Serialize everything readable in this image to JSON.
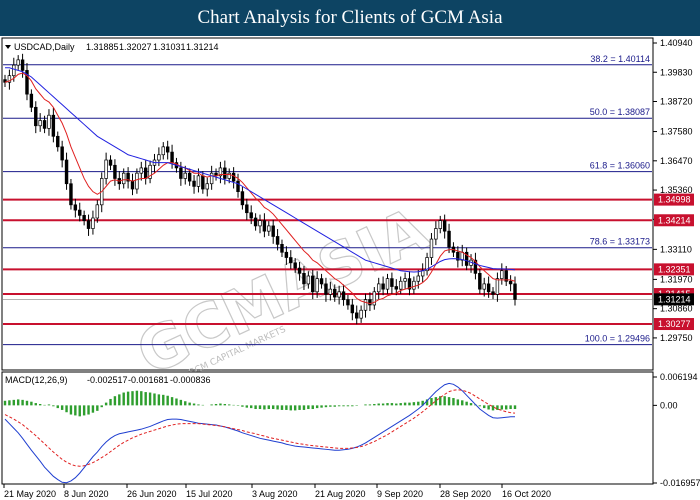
{
  "banner": {
    "title": "Chart Analysis for Clients of GCM Asia"
  },
  "header": {
    "symbol": "USDCAD,Daily",
    "open": "1.31885",
    "high": "1.32027",
    "low": "1.31031",
    "close": "1.31214"
  },
  "watermark": {
    "text": "GCMASIA",
    "sub": "GCM CAPITAL MARKETS"
  },
  "macd": {
    "label": "MACD(12,26,9)",
    "values": [
      "-0.002517",
      "-0.001681",
      "-0.000836"
    ]
  },
  "colors": {
    "banner": "#0d4463",
    "ma_fast": "#e02020",
    "ma_slow": "#2020e0",
    "resistance": "#c8102e",
    "fib": "#1a1a8a",
    "macd_hist": "#2e9e2e",
    "macd_line": "#1f3fd0",
    "macd_signal": "#e02020"
  },
  "chart_data": [
    {
      "type": "candlestick",
      "ylim": [
        1.2895,
        1.4094
      ],
      "yticks": [
        "1.40940",
        "1.39830",
        "1.38720",
        "1.37580",
        "1.36470",
        "1.35360",
        "1.34250",
        "1.33110",
        "1.31970",
        "1.30860",
        "1.29750"
      ],
      "xlabels": [
        "21 May 2020",
        "8 Jun 2020",
        "26 Jun 2020",
        "15 Jul 2020",
        "3 Aug 2020",
        "21 Aug 2020",
        "9 Sep 2020",
        "28 Sep 2020",
        "16 Oct 2020"
      ],
      "closes": [
        1.3945,
        1.397,
        1.401,
        1.403,
        1.399,
        1.39,
        1.385,
        1.378,
        1.38,
        1.377,
        1.382,
        1.374,
        1.37,
        1.365,
        1.356,
        1.348,
        1.346,
        1.344,
        1.342,
        1.339,
        1.343,
        1.348,
        1.358,
        1.365,
        1.363,
        1.358,
        1.356,
        1.36,
        1.357,
        1.354,
        1.36,
        1.362,
        1.358,
        1.363,
        1.365,
        1.367,
        1.37,
        1.368,
        1.364,
        1.362,
        1.358,
        1.36,
        1.357,
        1.355,
        1.359,
        1.354,
        1.356,
        1.36,
        1.359,
        1.362,
        1.358,
        1.36,
        1.357,
        1.353,
        1.348,
        1.345,
        1.343,
        1.34,
        1.342,
        1.338,
        1.34,
        1.336,
        1.333,
        1.33,
        1.328,
        1.326,
        1.324,
        1.322,
        1.318,
        1.321,
        1.315,
        1.32,
        1.318,
        1.314,
        1.316,
        1.313,
        1.315,
        1.312,
        1.31,
        1.307,
        1.305,
        1.308,
        1.312,
        1.31,
        1.315,
        1.318,
        1.316,
        1.32,
        1.317,
        1.316,
        1.319,
        1.32,
        1.316,
        1.319,
        1.321,
        1.323,
        1.328,
        1.335,
        1.339,
        1.342,
        1.338,
        1.332,
        1.33,
        1.327,
        1.33,
        1.325,
        1.327,
        1.322,
        1.316,
        1.318,
        1.315,
        1.314,
        1.32,
        1.323,
        1.319,
        1.318,
        1.3121
      ],
      "series": [
        {
          "values": [
            1.3945,
            1.395,
            1.396,
            1.3975,
            1.398,
            1.397,
            1.395,
            1.392,
            1.39,
            1.388,
            1.387,
            1.385,
            1.382,
            1.379,
            1.375,
            1.37,
            1.366,
            1.362,
            1.358,
            1.355,
            1.353,
            1.352,
            1.353,
            1.355,
            1.357,
            1.3575,
            1.357,
            1.3575,
            1.3575,
            1.357,
            1.3575,
            1.358,
            1.358,
            1.359,
            1.36,
            1.3615,
            1.363,
            1.364,
            1.364,
            1.3635,
            1.3625,
            1.362,
            1.361,
            1.36,
            1.36,
            1.359,
            1.3585,
            1.359,
            1.359,
            1.3595,
            1.3595,
            1.3595,
            1.359,
            1.358,
            1.3565,
            1.3545,
            1.3525,
            1.3505,
            1.349,
            1.347,
            1.346,
            1.3445,
            1.3425,
            1.3405,
            1.3385,
            1.3365,
            1.3345,
            1.3325,
            1.3305,
            1.329,
            1.327,
            1.326,
            1.3245,
            1.323,
            1.3215,
            1.32,
            1.319,
            1.3175,
            1.316,
            1.3145,
            1.3125,
            1.3115,
            1.311,
            1.3105,
            1.311,
            1.312,
            1.3125,
            1.3135,
            1.314,
            1.3145,
            1.3155,
            1.316,
            1.3165,
            1.317,
            1.3175,
            1.3185,
            1.32,
            1.3225,
            1.3255,
            1.3285,
            1.3305,
            1.331,
            1.331,
            1.3305,
            1.33,
            1.329,
            1.328,
            1.3265,
            1.3245,
            1.323,
            1.3215,
            1.32,
            1.3195,
            1.3195,
            1.3195,
            1.3195,
            1.319
          ]
        },
        {
          "values": [
            1.4,
            1.4,
            1.3995,
            1.399,
            1.3985,
            1.3975,
            1.3965,
            1.395,
            1.3935,
            1.392,
            1.3905,
            1.389,
            1.3875,
            1.386,
            1.3845,
            1.383,
            1.3815,
            1.38,
            1.3785,
            1.377,
            1.3755,
            1.374,
            1.373,
            1.372,
            1.371,
            1.37,
            1.369,
            1.368,
            1.367,
            1.3665,
            1.366,
            1.3655,
            1.365,
            1.3645,
            1.364,
            1.364,
            1.364,
            1.364,
            1.3635,
            1.363,
            1.3625,
            1.362,
            1.3615,
            1.361,
            1.3605,
            1.36,
            1.3595,
            1.359,
            1.3585,
            1.358,
            1.3575,
            1.357,
            1.3565,
            1.356,
            1.355,
            1.354,
            1.353,
            1.352,
            1.351,
            1.35,
            1.349,
            1.348,
            1.347,
            1.346,
            1.345,
            1.344,
            1.343,
            1.342,
            1.341,
            1.34,
            1.339,
            1.338,
            1.337,
            1.336,
            1.335,
            1.334,
            1.333,
            1.332,
            1.331,
            1.33,
            1.329,
            1.328,
            1.327,
            1.3265,
            1.326,
            1.3255,
            1.325,
            1.3245,
            1.324,
            1.3235,
            1.323,
            1.3228,
            1.3226,
            1.3225,
            1.3226,
            1.323,
            1.3236,
            1.3245,
            1.3255,
            1.3265,
            1.3272,
            1.3275,
            1.3276,
            1.3275,
            1.3272,
            1.3268,
            1.3262,
            1.3256,
            1.325,
            1.3246,
            1.3242,
            1.3238,
            1.3237,
            1.3237,
            1.3236,
            1.3235,
            1.3233
          ]
        }
      ],
      "fib_levels": [
        {
          "label": "38.2 = 1.40114",
          "value": 1.40114
        },
        {
          "label": "50.0 = 1.38087",
          "value": 1.38087
        },
        {
          "label": "61.8 = 1.36060",
          "value": 1.3606
        },
        {
          "label": "78.6 = 1.33173",
          "value": 1.33173
        },
        {
          "label": "100.0 = 1.29496",
          "value": 1.29496
        }
      ],
      "sr_levels": [
        {
          "label": "1.34998",
          "value": 1.34998
        },
        {
          "label": "1.34214",
          "value": 1.34214
        },
        {
          "label": "1.32351",
          "value": 1.32351
        },
        {
          "label": "1.31415",
          "value": 1.31415
        },
        {
          "label": "1.30277",
          "value": 1.30277
        }
      ],
      "current_price": {
        "label": "1.31214",
        "value": 1.31214
      }
    },
    {
      "type": "macd",
      "ylim": [
        -0.016957,
        0.006194
      ],
      "yticks": [
        "0.006194",
        "0.00",
        "-0.016957"
      ],
      "histogram": [
        0.001,
        0.0011,
        0.0012,
        0.0013,
        0.0012,
        0.001,
        0.0008,
        0.0005,
        0.0003,
        0.0001,
        0.0002,
        -0.0002,
        -0.0006,
        -0.001,
        -0.0015,
        -0.002,
        -0.0022,
        -0.0024,
        -0.0022,
        -0.002,
        -0.0016,
        -0.0012,
        -0.0004,
        0.0006,
        0.0014,
        0.002,
        0.0024,
        0.0028,
        0.003,
        0.0031,
        0.0032,
        0.0031,
        0.0029,
        0.0028,
        0.0026,
        0.0024,
        0.0023,
        0.0021,
        0.0018,
        0.0015,
        0.0012,
        0.0009,
        0.0006,
        0.0004,
        0.0002,
        0.0001,
        0.0,
        0.0002,
        0.0003,
        0.0004,
        0.0003,
        0.0002,
        0.0001,
        -0.0001,
        -0.0003,
        -0.0005,
        -0.0006,
        -0.0008,
        -0.0008,
        -0.0009,
        -0.0008,
        -0.0008,
        -0.0009,
        -0.001,
        -0.001,
        -0.0011,
        -0.0011,
        -0.001,
        -0.001,
        -0.0008,
        -0.0008,
        -0.0006,
        -0.0005,
        -0.0004,
        -0.0003,
        -0.0003,
        -0.0002,
        -0.0002,
        -0.0002,
        -0.0002,
        -0.0001,
        0.0,
        0.0002,
        0.0002,
        0.0003,
        0.0004,
        0.0004,
        0.0005,
        0.0005,
        0.0004,
        0.0005,
        0.0006,
        0.0006,
        0.0007,
        0.0008,
        0.001,
        0.0013,
        0.0016,
        0.0018,
        0.002,
        0.002,
        0.0018,
        0.0016,
        0.0013,
        0.0011,
        0.0008,
        0.0005,
        0.0002,
        -0.0002,
        -0.0006,
        -0.0009,
        -0.0011,
        -0.001,
        -0.0009,
        -0.0009,
        -0.0008,
        -0.0008
      ],
      "series": [
        {
          "values": [
            -0.003,
            -0.004,
            -0.005,
            -0.006,
            -0.0072,
            -0.0085,
            -0.0098,
            -0.011,
            -0.0122,
            -0.0135,
            -0.0145,
            -0.0155,
            -0.0162,
            -0.0168,
            -0.0169,
            -0.0165,
            -0.0158,
            -0.0148,
            -0.0136,
            -0.0124,
            -0.0112,
            -0.0102,
            -0.009,
            -0.008,
            -0.0072,
            -0.0066,
            -0.0062,
            -0.006,
            -0.0058,
            -0.0056,
            -0.0054,
            -0.0052,
            -0.0049,
            -0.0046,
            -0.0042,
            -0.0038,
            -0.0034,
            -0.0031,
            -0.003,
            -0.003,
            -0.0031,
            -0.0033,
            -0.0035,
            -0.0037,
            -0.0039,
            -0.004,
            -0.0041,
            -0.0042,
            -0.0043,
            -0.0045,
            -0.0047,
            -0.005,
            -0.0053,
            -0.0056,
            -0.006,
            -0.0063,
            -0.0066,
            -0.0069,
            -0.0072,
            -0.0074,
            -0.0076,
            -0.0078,
            -0.008,
            -0.0082,
            -0.0085,
            -0.0087,
            -0.0089,
            -0.009,
            -0.0091,
            -0.0092,
            -0.0093,
            -0.0094,
            -0.0095,
            -0.0096,
            -0.0097,
            -0.0098,
            -0.0098,
            -0.0097,
            -0.0096,
            -0.0094,
            -0.0091,
            -0.0087,
            -0.0082,
            -0.0076,
            -0.007,
            -0.0064,
            -0.0058,
            -0.0052,
            -0.0046,
            -0.004,
            -0.0034,
            -0.0028,
            -0.0022,
            -0.0015,
            -0.0008,
            0.0,
            0.001,
            0.002,
            0.003,
            0.0038,
            0.0045,
            0.0048,
            0.0046,
            0.004,
            0.0032,
            0.0022,
            0.0012,
            0.0002,
            -0.0008,
            -0.0015,
            -0.0022,
            -0.0027,
            -0.0028,
            -0.0027,
            -0.0026,
            -0.0025,
            -0.0025
          ]
        },
        {
          "values": [
            -0.002,
            -0.0025,
            -0.003,
            -0.0036,
            -0.0042,
            -0.005,
            -0.0058,
            -0.0066,
            -0.0075,
            -0.0084,
            -0.0093,
            -0.0102,
            -0.011,
            -0.0118,
            -0.0124,
            -0.0129,
            -0.0132,
            -0.0133,
            -0.0132,
            -0.0129,
            -0.0125,
            -0.012,
            -0.0114,
            -0.0108,
            -0.0101,
            -0.0094,
            -0.0087,
            -0.0081,
            -0.0076,
            -0.0071,
            -0.0067,
            -0.0063,
            -0.006,
            -0.0057,
            -0.0054,
            -0.0051,
            -0.0048,
            -0.0045,
            -0.0043,
            -0.0041,
            -0.004,
            -0.004,
            -0.004,
            -0.004,
            -0.004,
            -0.0041,
            -0.0042,
            -0.0043,
            -0.0044,
            -0.0045,
            -0.0047,
            -0.0049,
            -0.0051,
            -0.0053,
            -0.0055,
            -0.0058,
            -0.006,
            -0.0062,
            -0.0065,
            -0.0067,
            -0.007,
            -0.0072,
            -0.0074,
            -0.0076,
            -0.0078,
            -0.008,
            -0.0082,
            -0.0084,
            -0.0085,
            -0.0087,
            -0.0088,
            -0.0089,
            -0.009,
            -0.0091,
            -0.0092,
            -0.0093,
            -0.0094,
            -0.0094,
            -0.0094,
            -0.0093,
            -0.0092,
            -0.009,
            -0.0087,
            -0.0083,
            -0.0079,
            -0.0074,
            -0.0069,
            -0.0064,
            -0.0058,
            -0.0052,
            -0.0046,
            -0.004,
            -0.0034,
            -0.0028,
            -0.0021,
            -0.0014,
            -0.0006,
            0.0002,
            0.001,
            0.0017,
            0.0024,
            0.003,
            0.0033,
            0.0034,
            0.0033,
            0.003,
            0.0026,
            0.002,
            0.0014,
            0.0008,
            0.0002,
            -0.0003,
            -0.0008,
            -0.0011,
            -0.0014,
            -0.0016,
            -0.0017
          ]
        }
      ]
    }
  ]
}
